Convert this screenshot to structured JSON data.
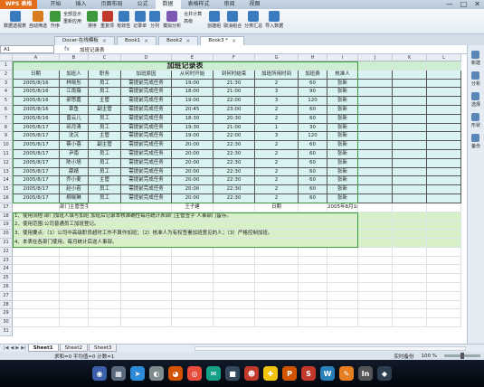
{
  "app": {
    "badge": "WPS 表格"
  },
  "menu": [
    "开始",
    "插入",
    "页面布局",
    "公式",
    "数据",
    "表格样式",
    "审阅",
    "视图"
  ],
  "menu_active_index": 4,
  "window_controls": [
    "—",
    "□",
    "✕"
  ],
  "ribbon": {
    "buttons": [
      {
        "label": "数据透视表",
        "color": "#3a7abf"
      },
      {
        "label": "自动筛选",
        "color": "#d97c1f"
      },
      {
        "label": "升序",
        "color": "#3c9a3c"
      },
      {
        "label": "排序",
        "color": "#3c9a3c"
      },
      {
        "label": "重复项",
        "color": "#c0392b"
      },
      {
        "label": "有效性",
        "color": "#3a7abf"
      },
      {
        "label": "记录单",
        "color": "#3a7abf"
      },
      {
        "label": "分列",
        "color": "#3a7abf"
      },
      {
        "label": "模拟分析",
        "color": "#7d5bb5"
      },
      {
        "label": "创建组",
        "color": "#3a7abf"
      },
      {
        "label": "取消组合",
        "color": "#3a7abf"
      },
      {
        "label": "分类汇总",
        "color": "#3a7abf"
      },
      {
        "label": "导入数据",
        "color": "#3a7abf"
      }
    ],
    "group1": [
      "全部显示",
      "重新应用"
    ],
    "group2": [
      "合并计算",
      "高级"
    ]
  },
  "tabs": [
    {
      "label": "Docer-在线模板",
      "active": false
    },
    {
      "label": "Book1",
      "active": false
    },
    {
      "label": "Book2",
      "active": false
    },
    {
      "label": "Book3 *",
      "active": true
    }
  ],
  "formula": {
    "cell": "A1",
    "fx": "fx",
    "value": "加班记录表"
  },
  "columns": [
    "A",
    "B",
    "C",
    "D",
    "E",
    "F",
    "G",
    "H",
    "I",
    "J",
    "K",
    "L"
  ],
  "rows": [
    "1",
    "2",
    "3",
    "4",
    "5",
    "6",
    "7",
    "8",
    "9",
    "10",
    "11",
    "12",
    "13",
    "14",
    "15",
    "16",
    "17",
    "18",
    "19",
    "20",
    "21",
    "22",
    "23",
    "24",
    "25",
    "26",
    "27",
    "28",
    "29",
    "30",
    "31"
  ],
  "sheet": {
    "title": "加班记录表",
    "headers": [
      "日期",
      "加班人",
      "职务",
      "加班原因",
      "从何时开始",
      "到何时结束",
      "加班所用时间",
      "加班费",
      "核准人"
    ],
    "records": [
      [
        "2005/8/16",
        "林晓彤",
        "员工",
        "需提前完成任务",
        "19:00",
        "21:30",
        "2",
        "60",
        "张新"
      ],
      [
        "2005/8/16",
        "江雨薇",
        "员工",
        "需提前完成任务",
        "18:00",
        "21:00",
        "3",
        "90",
        "张新"
      ],
      [
        "2005/8/16",
        "郝思嘉",
        "主管",
        "需提前完成任务",
        "19:00",
        "22:00",
        "3",
        "120",
        "张新"
      ],
      [
        "2005/8/16",
        "章鱼",
        "副主管",
        "需提前完成任务",
        "20:45",
        "23:00",
        "2",
        "60",
        "张新"
      ],
      [
        "2005/8/16",
        "曾云儿",
        "员工",
        "需提前完成任务",
        "18:30",
        "20:30",
        "2",
        "60",
        "张新"
      ],
      [
        "2005/8/17",
        "邱月清",
        "员工",
        "需提前完成任务",
        "19:30",
        "21:00",
        "1",
        "30",
        "张新"
      ],
      [
        "2005/8/17",
        "沈沉",
        "主管",
        "需提前完成任务",
        "19:00",
        "22:00",
        "3",
        "120",
        "张新"
      ],
      [
        "2005/8/17",
        "蔡小蓓",
        "副主管",
        "需提前完成任务",
        "20:00",
        "22:30",
        "2",
        "60",
        "张新"
      ],
      [
        "2005/8/17",
        "尹南",
        "员工",
        "需提前完成任务",
        "20:00",
        "22:30",
        "2",
        "60",
        "张新"
      ],
      [
        "2005/8/17",
        "陈小旭",
        "员工",
        "需提前完成任务",
        "20:00",
        "22:30",
        "2",
        "60",
        "张新"
      ],
      [
        "2005/8/17",
        "薛婧",
        "员工",
        "需提前完成任务",
        "20:00",
        "22:30",
        "2",
        "60",
        "张新"
      ],
      [
        "2005/8/17",
        "乔小麦",
        "主管",
        "需提前完成任务",
        "20:00",
        "22:30",
        "2",
        "60",
        "张新"
      ],
      [
        "2005/8/17",
        "赵小若",
        "员工",
        "需提前完成任务",
        "20:00",
        "22:30",
        "2",
        "60",
        "张新"
      ],
      [
        "2005/8/17",
        "柳晓琳",
        "员工",
        "需提前完成任务",
        "20:00",
        "22:30",
        "2",
        "60",
        "张新"
      ]
    ],
    "signature": {
      "label1": "部门主管签字",
      "name": "王子建",
      "label2": "日期",
      "date": "2005年8月18日"
    },
    "notes": [
      "1、使用流程:部门加班人填写加班 加班后记录本核准确性每月统计表部门主管签字 人事部门留存。",
      "2、使用范围:公司普通员工加班登记。",
      "3、使用要点:（1）公司中高级职员超时工作不算作加班；（2）核准人为有权签署加班意见的人；（3）严格控制加班。",
      "4、本表在各部门使用，每月统计后送人事部。"
    ]
  },
  "right_panel": [
    "新建",
    "分析",
    "选择",
    "形状",
    "备份"
  ],
  "sheet_tabs": [
    {
      "label": "Sheet1",
      "active": true
    },
    {
      "label": "Sheet2",
      "active": false
    },
    {
      "label": "Sheet3",
      "active": false
    }
  ],
  "status": {
    "summary": "求和=0  平均值=0  计数=1",
    "backup": "实时备份",
    "zoom": "100 %"
  },
  "dock": [
    {
      "glyph": "◉",
      "color": "#3b5fa8"
    },
    {
      "glyph": "▦",
      "color": "#5b6a7d"
    },
    {
      "glyph": "➤",
      "color": "#2d8ad6"
    },
    {
      "glyph": "◐",
      "color": "#7f8c8d"
    },
    {
      "glyph": "◕",
      "color": "#d35400"
    },
    {
      "glyph": "◎",
      "color": "#e74c3c"
    },
    {
      "glyph": "✉",
      "color": "#16a085"
    },
    {
      "glyph": "■",
      "color": "#34495e"
    },
    {
      "glyph": "☻",
      "color": "#c0392b"
    },
    {
      "glyph": "✚",
      "color": "#f1c40f"
    },
    {
      "glyph": "P",
      "color": "#d35400"
    },
    {
      "glyph": "S",
      "color": "#c0392b"
    },
    {
      "glyph": "W",
      "color": "#2980b9"
    },
    {
      "glyph": "✎",
      "color": "#e67e22"
    },
    {
      "glyph": "In",
      "color": "#555555"
    },
    {
      "glyph": "◆",
      "color": "#2c3e50"
    }
  ]
}
